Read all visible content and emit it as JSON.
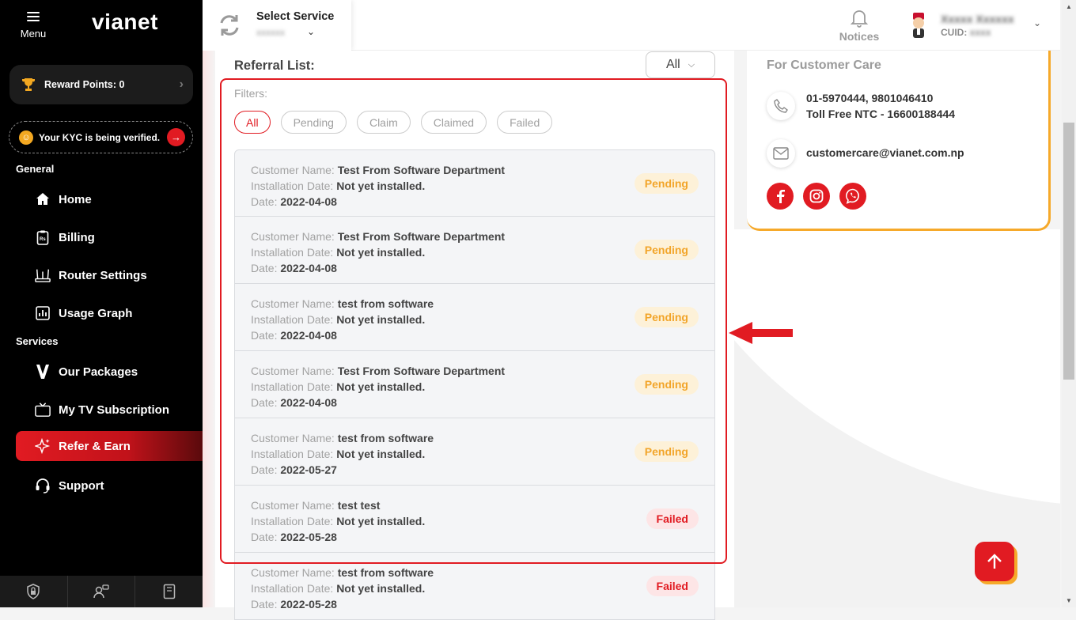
{
  "sidebar": {
    "menu_label": "Menu",
    "logo_text": "vianet",
    "reward_points": "Reward Points: 0",
    "kyc_text": "Your KYC is being verified.",
    "section_general": "General",
    "section_services": "Services",
    "items": [
      {
        "label": "Home",
        "icon": "home-icon"
      },
      {
        "label": "Billing",
        "icon": "bill-icon"
      },
      {
        "label": "Router Settings",
        "icon": "router-icon"
      },
      {
        "label": "Usage Graph",
        "icon": "graph-icon"
      },
      {
        "label": "Our Packages",
        "icon": "v-icon"
      },
      {
        "label": "My TV Subscription",
        "icon": "tv-icon"
      },
      {
        "label": "Refer & Earn",
        "icon": "sparkle-icon",
        "active": true
      },
      {
        "label": "Support",
        "icon": "headset-icon"
      }
    ]
  },
  "header": {
    "select_service": "Select Service",
    "service_value": "xxxxxx",
    "notices_label": "Notices",
    "user_name": "Xxxxx Xxxxxx",
    "cuid_label": "CUID:",
    "cuid_value": "xxxx"
  },
  "referral": {
    "title": "Referral List:",
    "dropdown_value": "All",
    "filters_label": "Filters:",
    "filters": [
      "All",
      "Pending",
      "Claim",
      "Claimed",
      "Failed"
    ],
    "active_filter": "All",
    "field_labels": {
      "customer_name": "Customer Name:",
      "installation_date": "Installation Date:",
      "date": "Date:"
    },
    "entries": [
      {
        "name": "Test From Software Department",
        "installation": "Not yet installed.",
        "date": "2022-04-08",
        "status": "Pending"
      },
      {
        "name": "Test From Software Department",
        "installation": "Not yet installed.",
        "date": "2022-04-08",
        "status": "Pending"
      },
      {
        "name": "test from software",
        "installation": "Not yet installed.",
        "date": "2022-04-08",
        "status": "Pending"
      },
      {
        "name": "Test From Software Department",
        "installation": "Not yet installed.",
        "date": "2022-04-08",
        "status": "Pending"
      },
      {
        "name": "test from software",
        "installation": "Not yet installed.",
        "date": "2022-05-27",
        "status": "Pending"
      },
      {
        "name": "test test",
        "installation": "Not yet installed.",
        "date": "2022-05-28",
        "status": "Failed"
      },
      {
        "name": "test from software",
        "installation": "Not yet installed.",
        "date": "2022-05-28",
        "status": "Failed"
      }
    ]
  },
  "care": {
    "title": "For Customer Care",
    "phone": "01-5970444, 9801046410",
    "toll_free": "Toll Free NTC - 16600188444",
    "email": "customercare@vianet.com.np"
  },
  "colors": {
    "brand_red": "#e11b22",
    "accent_orange": "#f6a92a",
    "pending": "#f2a52a",
    "failed": "#e11b22"
  }
}
